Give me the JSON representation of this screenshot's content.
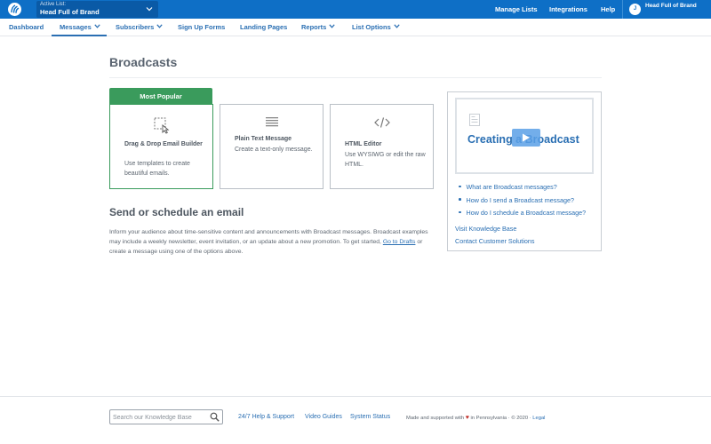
{
  "topbar": {
    "list_caption": "Active List:",
    "list_name": "Head Full of Brand",
    "links": [
      "Manage Lists",
      "Integrations",
      "Help"
    ],
    "avatar_initial": "J",
    "brand_name": "Head Full of Brand",
    "color": "#0e6fc6"
  },
  "nav": {
    "items": [
      "Dashboard",
      "Messages",
      "Subscribers",
      "Sign Up Forms",
      "Landing Pages",
      "Reports",
      "List Options"
    ],
    "active": "Messages"
  },
  "main": {
    "title": "Broadcasts",
    "popular_label": "Most Popular",
    "cards": [
      {
        "title": "Drag & Drop Email Builder",
        "desc": "Use templates to create beautiful emails.",
        "icon": "drag-drop-icon"
      },
      {
        "title": "Plain Text Message",
        "desc": "Create a text-only message.",
        "icon": "text-lines-icon"
      },
      {
        "title": "HTML Editor",
        "desc": "Use WYSIWG or edit the raw HTML.",
        "icon": "code-icon"
      }
    ],
    "section_title": "Send or schedule an email",
    "section_text_1": "Inform your audience about time-sensitive content and announcements with Broadcast messages. Broadcast examples may include a weekly newsletter, event invitation, or an update about a new promotion. To get started,",
    "section_link": "Go to Drafts",
    "section_text_2": "or create a message using one of the options above."
  },
  "side": {
    "video_title": "Creating a Broadcast",
    "faq": [
      "What are Broadcast messages?",
      "How do I send a Broadcast message?",
      "How do I schedule a Broadcast message?"
    ],
    "kb_link": "Visit Knowledge Base",
    "contact_link": "Contact Customer Solutions"
  },
  "footer": {
    "search_placeholder": "Search our Knowledge Base",
    "links": [
      "24/7 Help & Support",
      "Video Guides",
      "System Status"
    ],
    "made_text_1": "Made and supported with",
    "made_text_2": "in Pennsylvania",
    "copyright": "© 2020",
    "legal": "Legal",
    "accent": "#c0302b"
  }
}
